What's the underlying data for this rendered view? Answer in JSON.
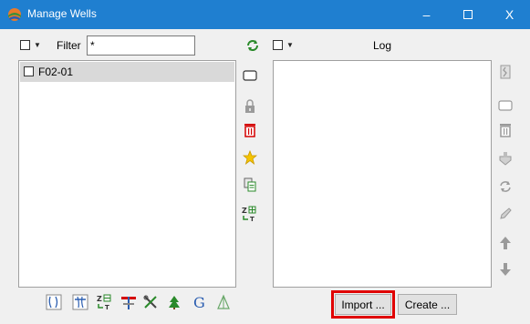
{
  "window": {
    "title": "Manage Wells",
    "controls": {
      "minimize": "–",
      "close": "X"
    }
  },
  "wells": {
    "filter_label": "Filter",
    "filter_value": "*",
    "items": [
      {
        "label": "F02-01",
        "checked": false,
        "selected": true
      }
    ]
  },
  "log": {
    "header_label": "Log"
  },
  "buttons": {
    "import_label": "Import ...",
    "create_label": "Create ..."
  },
  "middle_tools": [
    "remove-icon",
    "lock-icon",
    "delete-icon",
    "star-icon",
    "copy-icon",
    "depth-model-icon"
  ],
  "right_tools": [
    "log-tool-icon",
    "remove-icon",
    "delete-icon",
    "export-icon",
    "convert-icon",
    "edit-icon",
    "move-up-icon",
    "move-down-icon"
  ],
  "bottom_tools": [
    "track-edit-icon",
    "marker-icon",
    "depth-model-icon",
    "well-tie-icon",
    "tools-icon",
    "log-tools-icon",
    "g-icon",
    "simple-log-icon"
  ],
  "colors": {
    "titlebar": "#1f7fd0",
    "highlight": "#e00000",
    "accent_green": "#2a8a2a"
  }
}
